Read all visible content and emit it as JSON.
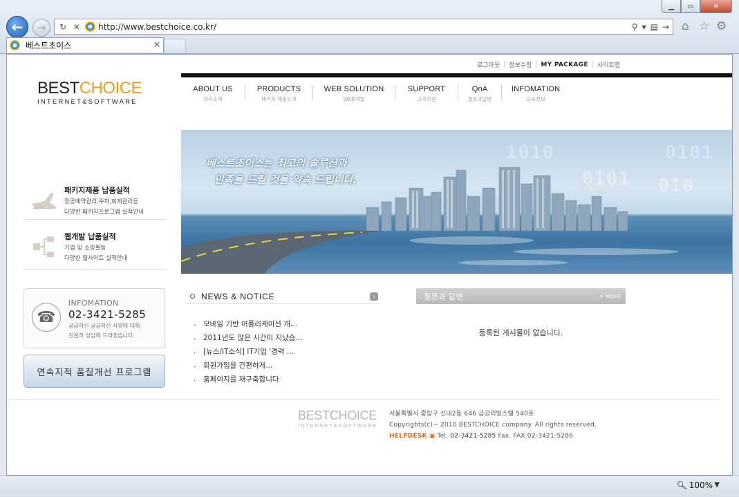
{
  "browser": {
    "url": "http://www.bestchoice.co.kr/",
    "tab_title": "베스트초이스",
    "tab_close": "✕",
    "zoom": "100%"
  },
  "site": {
    "top_links": [
      "로그아웃",
      "정보수정",
      "MY PACKAGE",
      "사이트맵"
    ],
    "logo": {
      "best": "BEST",
      "choice": "CHOICE",
      "sub": "INTERNET&SOFTWARE"
    },
    "nav": [
      {
        "en": "ABOUT US",
        "ko": "회사소개"
      },
      {
        "en": "PRODUCTS",
        "ko": "패키지 제품소개"
      },
      {
        "en": "WEB SOLUTION",
        "ko": "WEB개발"
      },
      {
        "en": "SUPPORT",
        "ko": "고객지원"
      },
      {
        "en": "QnA",
        "ko": "질문과답변"
      },
      {
        "en": "INFOMATION",
        "ko": "교육정보"
      }
    ],
    "banner": {
      "line1": "베스트초이스는 최고의 솔루션과",
      "line2": "만족을 드릴 것을 약속 드립니다."
    },
    "promos": [
      {
        "title": "패키지제품 납품실적",
        "desc1": "항공예약관리,주차,회계관리등",
        "desc2": "다양한 패키지프로그램 실적안내"
      },
      {
        "title": "웹개발 납품실적",
        "desc1": "기업 및 쇼핑몰등",
        "desc2": "다양한 웹사이트 실적안내"
      }
    ],
    "info": {
      "label": "INFOMATION",
      "phone": "02-3421-5285",
      "desc1": "궁금하신 궁금하신 사항에 대해",
      "desc2": "친절히 상담해 드리겠습니다."
    },
    "quality_button": "연속지적 품질개선 프로그램",
    "news": {
      "title": "NEWS & NOTICE",
      "more": "›",
      "items": [
        "모바일 기반 어플리케이션 개...",
        "2011년도 많은 시간이 지났습...",
        "[뉴스/IT소식] IT기업 '경력 ...",
        "회원가입을 간편하게...",
        "홈페이지를 재구축합니다"
      ]
    },
    "qna": {
      "title": "질문과 답변",
      "more": "+ MORE",
      "empty": "등록된 게시물이 없습니다."
    },
    "footer": {
      "logo_best": "BEST",
      "logo_choice": "CHOICE",
      "logo_sub": "INTERNET&SOFTWARE",
      "address": "서울특별시 중랑구 신내2동 646  금강리빙스텔 540호",
      "copyright": "Copyrights(c)~ 2010 BESTCHOICE company. All rights reserved.",
      "helpdesk": "HELPDESK",
      "tel_label": "Tel.",
      "tel": "02-3421-5285",
      "fax": "Fax. FAX:02-3421-5286"
    }
  }
}
